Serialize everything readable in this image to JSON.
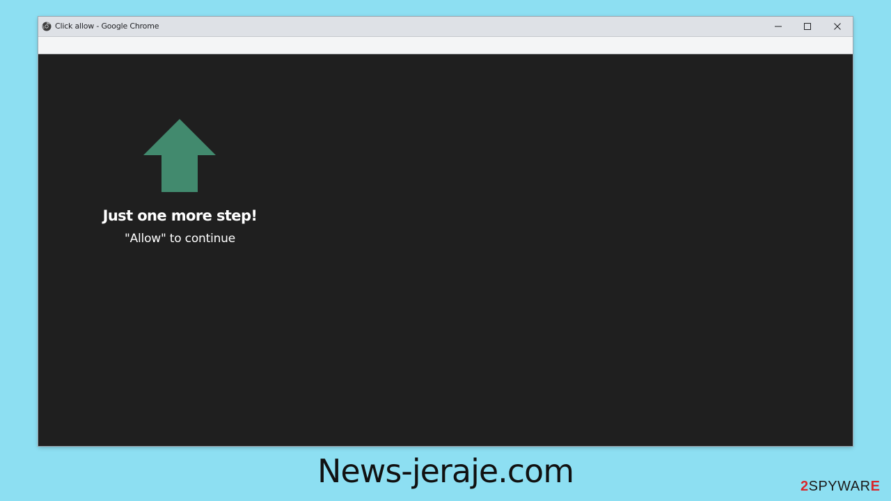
{
  "window": {
    "title": "Click allow - Google Chrome",
    "controls": {
      "minimize": "minimize-icon",
      "maximize": "maximize-icon",
      "close": "close-icon"
    }
  },
  "page": {
    "arrow_icon": "up-arrow-icon",
    "arrow_color": "#428a6e",
    "headline": "Just one more step!",
    "subline": "\"Allow\" to continue",
    "background": "#1f1f1f"
  },
  "caption": {
    "text": "News-jeraje.com"
  },
  "watermark": {
    "prefix": "2",
    "middle": "SPYWAR",
    "suffix": "E"
  },
  "colors": {
    "desktop_background": "#8ddff2",
    "titlebar": "#dee1e6",
    "accent_red": "#d9262b"
  }
}
